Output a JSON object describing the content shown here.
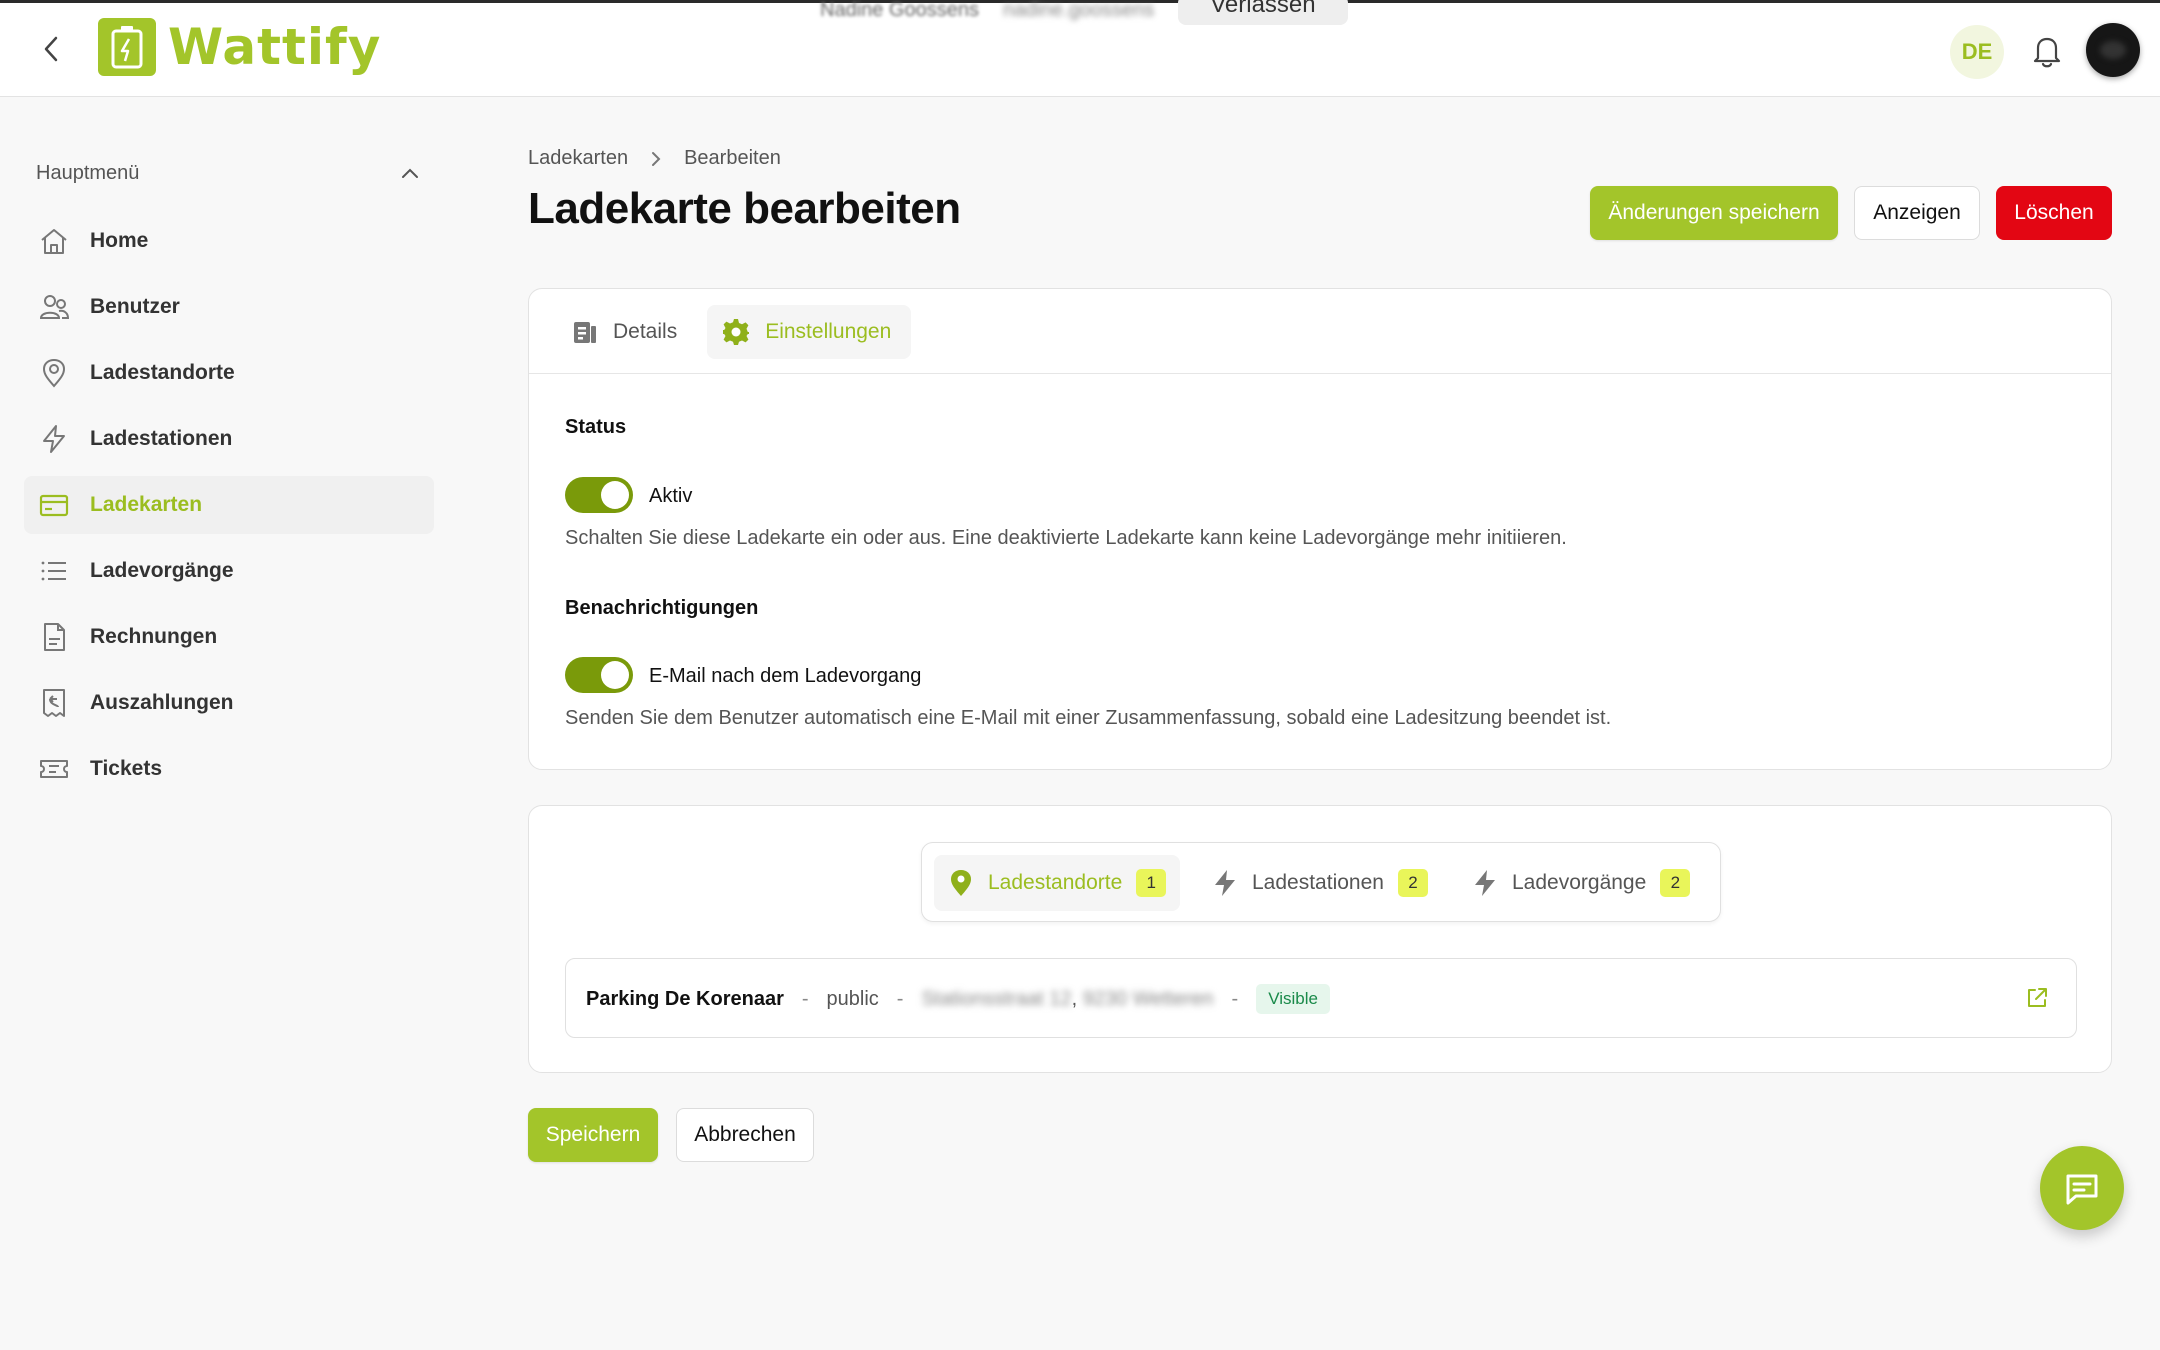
{
  "app": {
    "brand": "Wattify"
  },
  "header": {
    "impersonation_text": "Nadine Goossens",
    "impersonation_blur": "nadine.goossens",
    "leave_label": "Verlassen",
    "language": "DE"
  },
  "sidebar": {
    "section_title": "Hauptmenü",
    "items": [
      {
        "label": "Home",
        "icon": "home-icon"
      },
      {
        "label": "Benutzer",
        "icon": "users-icon"
      },
      {
        "label": "Ladestandorte",
        "icon": "location-pin-icon"
      },
      {
        "label": "Ladestationen",
        "icon": "lightning-icon"
      },
      {
        "label": "Ladekarten",
        "icon": "credit-card-icon",
        "active": true
      },
      {
        "label": "Ladevorgänge",
        "icon": "list-icon"
      },
      {
        "label": "Rechnungen",
        "icon": "document-icon"
      },
      {
        "label": "Auszahlungen",
        "icon": "receipt-icon"
      },
      {
        "label": "Tickets",
        "icon": "ticket-icon"
      }
    ]
  },
  "breadcrumb": {
    "parent": "Ladekarten",
    "current": "Bearbeiten"
  },
  "page": {
    "title": "Ladekarte bearbeiten"
  },
  "actions": {
    "save_changes": "Änderungen speichern",
    "view": "Anzeigen",
    "delete": "Löschen"
  },
  "settings": {
    "tabs": [
      {
        "label": "Details",
        "icon": "document-icon"
      },
      {
        "label": "Einstellungen",
        "icon": "gear-icon",
        "active": true
      }
    ],
    "status_title": "Status",
    "active_label": "Aktiv",
    "active_on": true,
    "active_hint": "Schalten Sie diese Ladekarte ein oder aus. Eine deaktivierte Ladekarte kann keine Ladevorgänge mehr initiieren.",
    "notifications_title": "Benachrichtigungen",
    "email_label": "E-Mail nach dem Ladevorgang",
    "email_on": true,
    "email_hint": "Senden Sie dem Benutzer automatisch eine E-Mail mit einer Zusammenfassung, sobald eine Ladesitzung beendet ist."
  },
  "related": {
    "tabs": [
      {
        "label": "Ladestandorte",
        "count": "1",
        "icon": "location-pin-icon",
        "active": true
      },
      {
        "label": "Ladestationen",
        "count": "2",
        "icon": "lightning-icon"
      },
      {
        "label": "Ladevorgänge",
        "count": "2",
        "icon": "lightning-icon"
      }
    ],
    "rows": [
      {
        "name": "Parking De Korenaar",
        "type": "public",
        "address_part1": "Stationsstraat 12",
        "address_part2": "9230 Wetteren",
        "badge": "Visible"
      }
    ]
  },
  "footer": {
    "save": "Speichern",
    "cancel": "Abbrechen"
  },
  "colors": {
    "accent": "#a3c52a",
    "toggle": "#7a9a0a",
    "danger": "#e30613",
    "count_badge": "#e9f55a",
    "visible_badge_bg": "#e6f6ec"
  }
}
